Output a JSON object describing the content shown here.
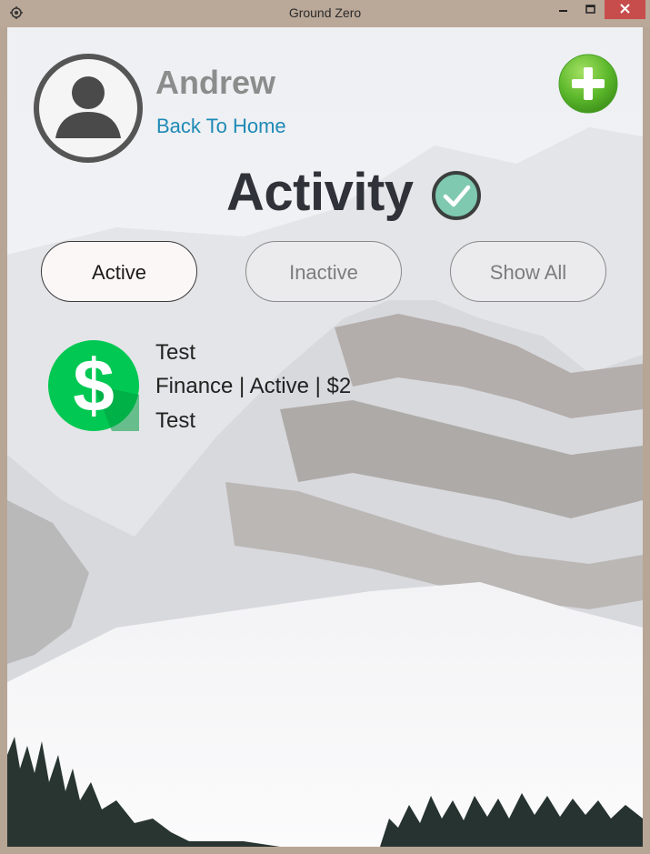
{
  "window": {
    "title": "Ground Zero"
  },
  "header": {
    "user_name": "Andrew",
    "back_link": "Back To Home"
  },
  "page": {
    "title": "Activity"
  },
  "filters": [
    {
      "label": "Active",
      "selected": true
    },
    {
      "label": "Inactive",
      "selected": false
    },
    {
      "label": "Show All",
      "selected": false
    }
  ],
  "activities": [
    {
      "title": "Test",
      "details": "Finance | Active | $2",
      "description": "Test",
      "icon": "dollar-icon"
    }
  ],
  "colors": {
    "accent_link": "#1e8ab6",
    "add_button": "#5cb82b",
    "check_badge": "#7fc9b0",
    "dollar_icon": "#00c853",
    "close_button": "#c74d4d"
  }
}
